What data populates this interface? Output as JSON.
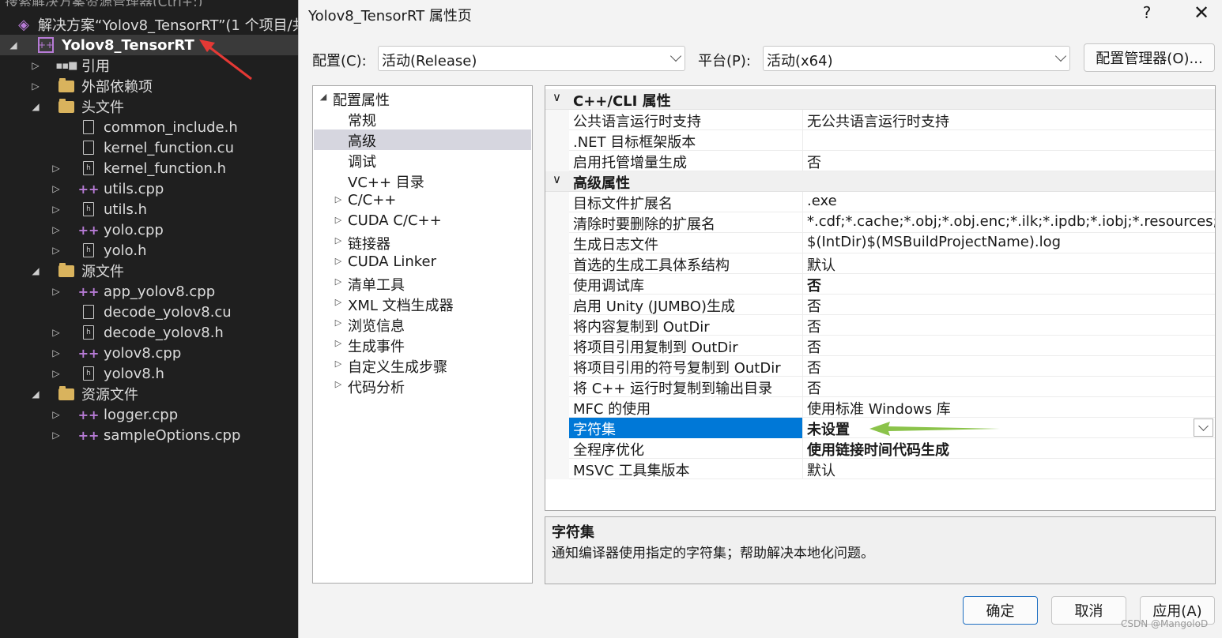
{
  "solution_explorer": {
    "search_placeholder": "搜索解决方案资源管理器(Ctrl+;)",
    "solution_label": "解决方案“Yolov8_TensorRT”(1 个项目/共",
    "project_label": "Yolov8_TensorRT",
    "items": [
      {
        "label": "引用"
      },
      {
        "label": "外部依赖项"
      },
      {
        "label": "头文件"
      },
      {
        "label": "common_include.h"
      },
      {
        "label": "kernel_function.cu"
      },
      {
        "label": "kernel_function.h"
      },
      {
        "label": "utils.cpp"
      },
      {
        "label": "utils.h"
      },
      {
        "label": "yolo.cpp"
      },
      {
        "label": "yolo.h"
      },
      {
        "label": "源文件"
      },
      {
        "label": "app_yolov8.cpp"
      },
      {
        "label": "decode_yolov8.cu"
      },
      {
        "label": "decode_yolov8.h"
      },
      {
        "label": "yolov8.cpp"
      },
      {
        "label": "yolov8.h"
      },
      {
        "label": "资源文件"
      },
      {
        "label": "logger.cpp"
      },
      {
        "label": "sampleOptions.cpp"
      }
    ]
  },
  "dialog": {
    "title": "Yolov8_TensorRT 属性页",
    "help": "?",
    "close": "✕",
    "config_label": "配置(C):",
    "config_value": "活动(Release)",
    "platform_label": "平台(P):",
    "platform_value": "活动(x64)",
    "config_manager": "配置管理器(O)...",
    "nav": [
      {
        "label": "配置属性"
      },
      {
        "label": "常规"
      },
      {
        "label": "高级"
      },
      {
        "label": "调试"
      },
      {
        "label": "VC++ 目录"
      },
      {
        "label": "C/C++"
      },
      {
        "label": "CUDA C/C++"
      },
      {
        "label": "链接器"
      },
      {
        "label": "CUDA Linker"
      },
      {
        "label": "清单工具"
      },
      {
        "label": "XML 文档生成器"
      },
      {
        "label": "浏览信息"
      },
      {
        "label": "生成事件"
      },
      {
        "label": "自定义生成步骤"
      },
      {
        "label": "代码分析"
      }
    ],
    "sections": [
      {
        "title": "C++/CLI 属性",
        "props": [
          {
            "name": "公共语言运行时支持",
            "value": "无公共语言运行时支持"
          },
          {
            "name": ".NET 目标框架版本",
            "value": ""
          },
          {
            "name": "启用托管增量生成",
            "value": "否"
          }
        ]
      },
      {
        "title": "高级属性",
        "props": [
          {
            "name": "目标文件扩展名",
            "value": ".exe"
          },
          {
            "name": "清除时要删除的扩展名",
            "value": "*.cdf;*.cache;*.obj;*.obj.enc;*.ilk;*.ipdb;*.iobj;*.resources;*.tlb;*"
          },
          {
            "name": "生成日志文件",
            "value": "$(IntDir)$(MSBuildProjectName).log"
          },
          {
            "name": "首选的生成工具体系结构",
            "value": "默认"
          },
          {
            "name": "使用调试库",
            "value": "否"
          },
          {
            "name": "启用 Unity (JUMBO)生成",
            "value": "否"
          },
          {
            "name": "将内容复制到 OutDir",
            "value": "否"
          },
          {
            "name": "将项目引用复制到 OutDir",
            "value": "否"
          },
          {
            "name": "将项目引用的符号复制到 OutDir",
            "value": "否"
          },
          {
            "name": "将 C++ 运行时复制到输出目录",
            "value": "否"
          },
          {
            "name": "MFC 的使用",
            "value": "使用标准 Windows 库"
          },
          {
            "name": "字符集",
            "value": "未设置"
          },
          {
            "name": "全程序优化",
            "value": "使用链接时间代码生成"
          },
          {
            "name": "MSVC 工具集版本",
            "value": "默认"
          }
        ]
      }
    ],
    "description": {
      "title": "字符集",
      "text": "通知编译器使用指定的字符集；帮助解决本地化问题。"
    },
    "buttons": {
      "ok": "确定",
      "cancel": "取消",
      "apply": "应用(A)"
    }
  },
  "watermark": "CSDN @MangoloD",
  "colors": {
    "selection_blue": "#0078d7",
    "annotation_red": "#e53935",
    "annotation_green": "#8bc34a"
  }
}
